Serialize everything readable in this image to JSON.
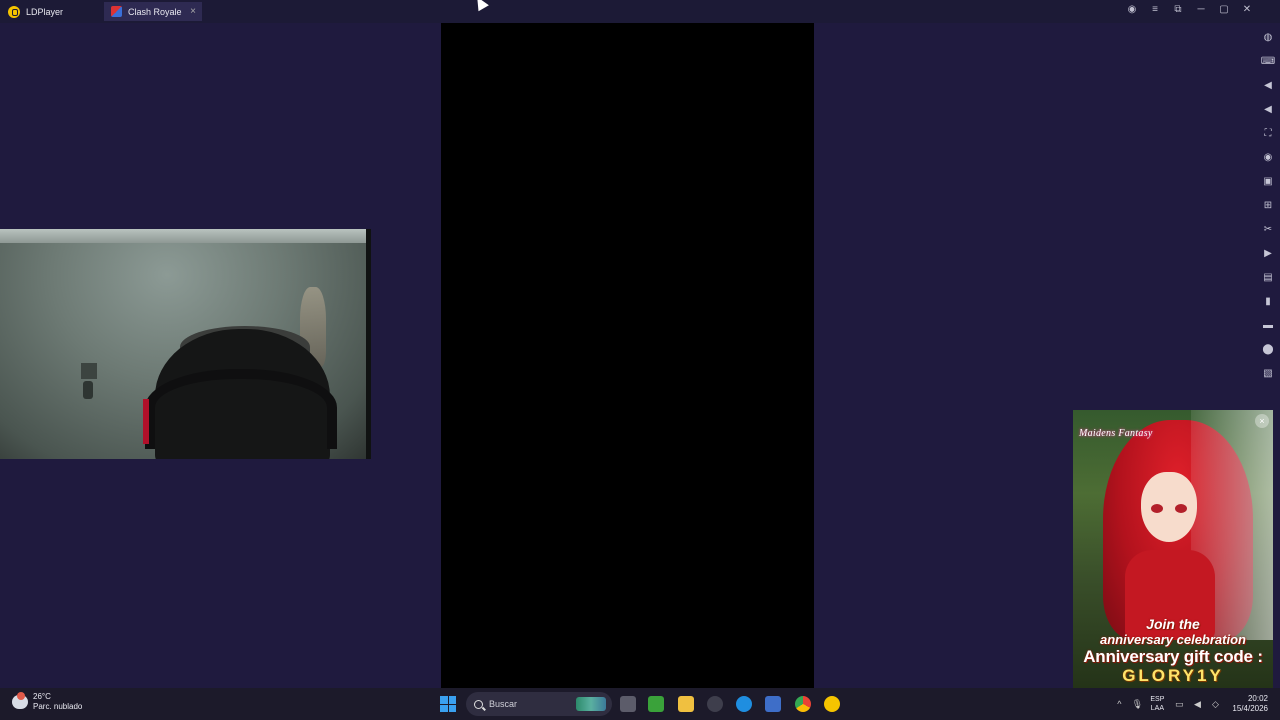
{
  "titlebar": {
    "app_name": "LDPlayer",
    "tab_title": "Clash Royale",
    "tab_close": "×",
    "controls": {
      "account": "◉",
      "menu": "≡",
      "restore_small": "⧉",
      "minimize": "─",
      "maximize": "▢",
      "close": "✕"
    }
  },
  "sidebar_tools": [
    {
      "name": "settings-icon",
      "glyph": "◍"
    },
    {
      "name": "keyboard-icon",
      "glyph": "⌨"
    },
    {
      "name": "volume-up-icon",
      "glyph": "◀"
    },
    {
      "name": "volume-down-icon",
      "glyph": "◀"
    },
    {
      "name": "fullscreen-icon",
      "glyph": "⛶"
    },
    {
      "name": "record-icon",
      "glyph": "◉"
    },
    {
      "name": "screenshot-icon",
      "glyph": "▣"
    },
    {
      "name": "operation-icon",
      "glyph": "⊞"
    },
    {
      "name": "scissors-icon",
      "glyph": "✂"
    },
    {
      "name": "video-icon",
      "glyph": "▶"
    },
    {
      "name": "apk-icon",
      "glyph": "▤"
    },
    {
      "name": "shake-icon",
      "glyph": "▮"
    },
    {
      "name": "folder-icon",
      "glyph": "▬"
    },
    {
      "name": "location-icon",
      "glyph": "⬤"
    },
    {
      "name": "multi-instance-icon",
      "glyph": "▧"
    }
  ],
  "ad": {
    "close": "×",
    "brand": "Maidens Fantasy",
    "line1": "Join the",
    "line2": "anniversary celebration",
    "line3": "Anniversary gift code :",
    "line4": "GLORY1Y"
  },
  "taskbar": {
    "temperature": "26°C",
    "weather": "Parc. nublado",
    "search_placeholder": "Buscar",
    "lang_top": "ESP",
    "lang_bottom": "LAA",
    "time": "20:02",
    "date": "15/4/2026",
    "tray_chevron": "^",
    "tray_mic": "🎙",
    "tray_net": "▭",
    "tray_vol": "◀",
    "tray_bell": "◇"
  },
  "colors": {
    "background": "#1f1a3e",
    "titlebar": "#1c1a36",
    "active_tab": "#2e2a52",
    "game_screen": "#000000",
    "taskbar": "#1c1a2a",
    "brand_yellow": "#f5c400"
  }
}
